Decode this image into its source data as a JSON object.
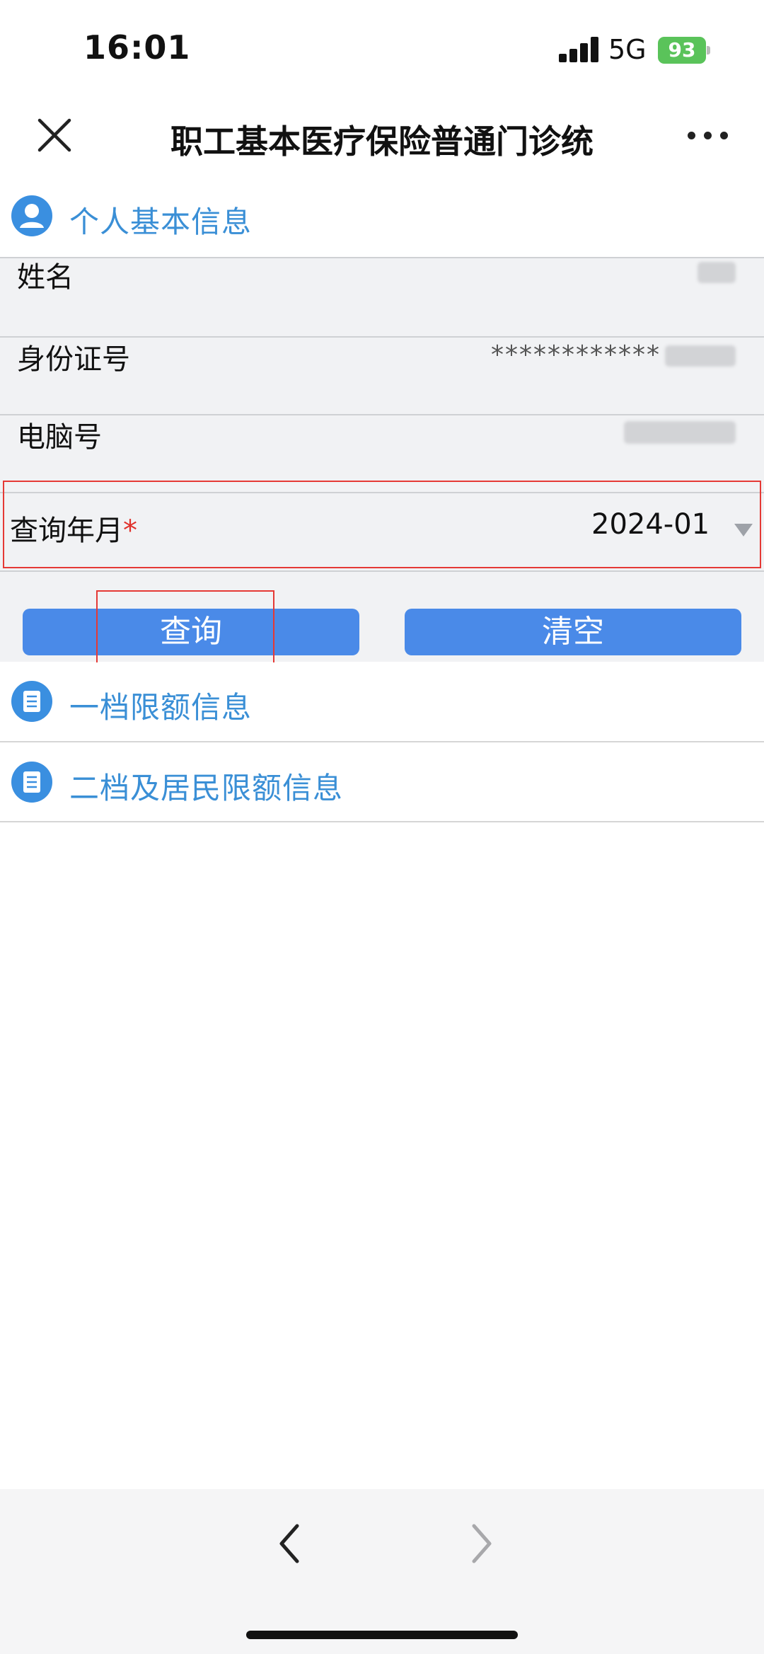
{
  "status_bar": {
    "time": "16:01",
    "network": "5G",
    "battery": "93"
  },
  "header": {
    "title": "职工基本医疗保险普通门诊统"
  },
  "personal_section": {
    "title": "个人基本信息"
  },
  "form": {
    "name_label": "姓名",
    "id_label": "身份证号",
    "id_value": "************",
    "computer_no_label": "电脑号",
    "query_month_label": "查询年月",
    "required_mark": "*",
    "query_month_value": "2024-01"
  },
  "buttons": {
    "query": "查询",
    "clear": "清空"
  },
  "sections": {
    "tier_one": "一档限额信息",
    "tier_two": "二档及居民限额信息"
  },
  "icons": {
    "close": "close-icon",
    "more": "more-icon",
    "person": "person-icon",
    "document": "document-icon",
    "back": "chevron-left-icon",
    "forward": "chevron-right-icon"
  },
  "colors": {
    "accent": "#3a8fd6",
    "button": "#4a8ae8",
    "highlight": "#e53935",
    "required": "#e0302a"
  }
}
